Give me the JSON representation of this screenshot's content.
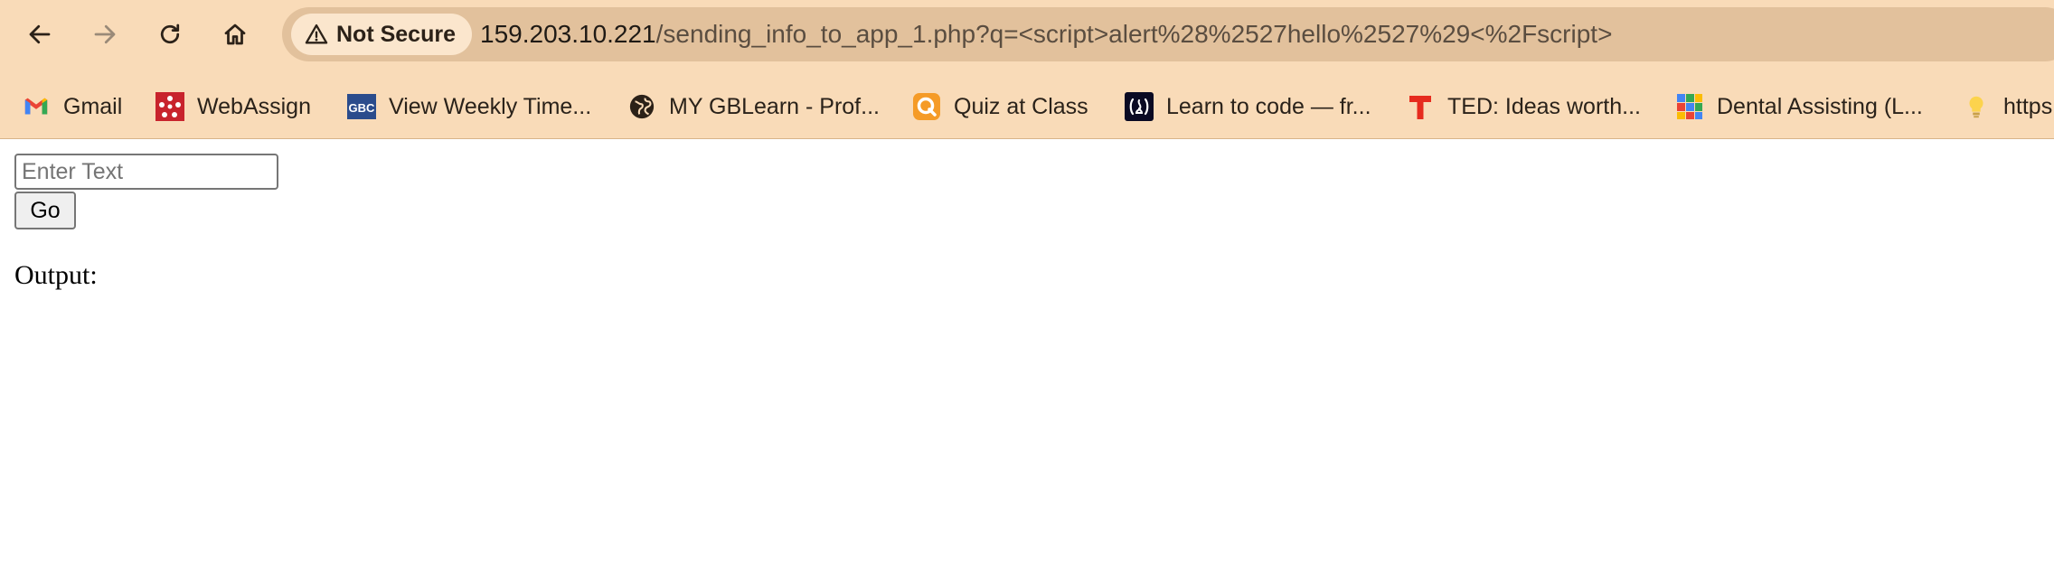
{
  "colors": {
    "chrome_background": "#f9dbb8",
    "omnibox_background": "#e2c19c",
    "security_chip_background": "#fbe6cd"
  },
  "toolbar": {
    "back_icon": "arrow-left-icon",
    "forward_icon": "arrow-right-icon",
    "reload_icon": "reload-icon",
    "home_icon": "home-icon"
  },
  "omnibox": {
    "security_label": "Not Secure",
    "security_icon": "warning-triangle-icon",
    "url_host": "159.203.10.221",
    "url_path": "/sending_info_to_app_1.php?q=<script>alert%28%2527hello%2527%29<%2Fscript>"
  },
  "bookmarks": [
    {
      "label": "Gmail",
      "icon": "gmail-icon"
    },
    {
      "label": "WebAssign",
      "icon": "webassign-icon"
    },
    {
      "label": "View Weekly Time...",
      "icon": "gbc-icon"
    },
    {
      "label": "MY GBLearn - Prof...",
      "icon": "globe-icon"
    },
    {
      "label": "Quiz at Class",
      "icon": "quiz-icon"
    },
    {
      "label": "Learn to code — fr...",
      "icon": "freecodecamp-icon"
    },
    {
      "label": "TED: Ideas worth...",
      "icon": "ted-icon"
    },
    {
      "label": "Dental Assisting (L...",
      "icon": "grid-icon"
    },
    {
      "label": "https",
      "icon": "lightbulb-icon"
    }
  ],
  "page": {
    "input_placeholder": "Enter Text",
    "input_value": "",
    "go_label": "Go",
    "output_label": "Output:"
  }
}
